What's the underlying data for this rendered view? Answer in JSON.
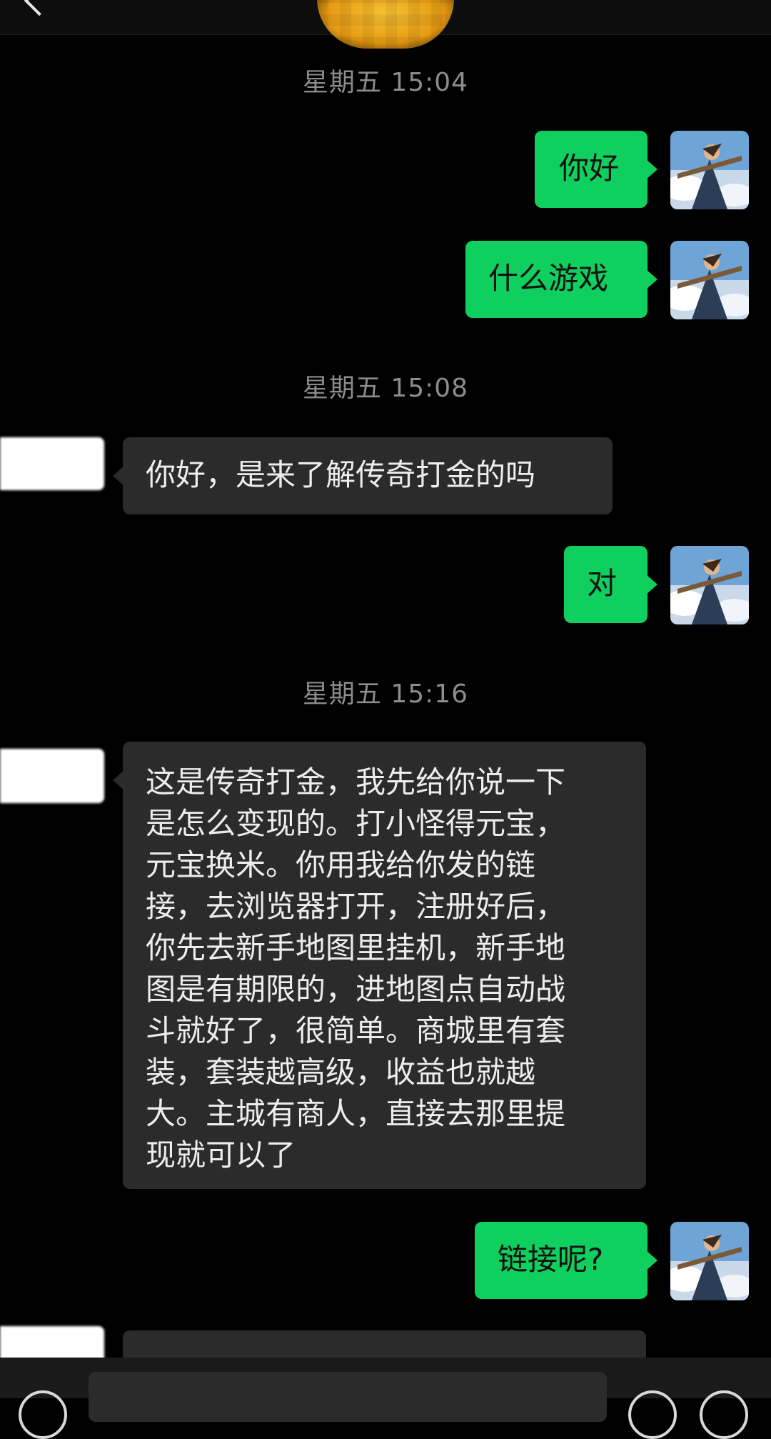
{
  "header": {
    "back_icon": "back-arrow-icon",
    "contact_avatar": "pixelated-emoji-avatar"
  },
  "messages": [
    {
      "type": "time",
      "text": "星期五 15:04"
    },
    {
      "type": "sent",
      "text": "你好"
    },
    {
      "type": "sent",
      "text": "什么游戏"
    },
    {
      "type": "time",
      "text": "星期五 15:08"
    },
    {
      "type": "received",
      "text": "你好，是来了解传奇打金的吗"
    },
    {
      "type": "sent",
      "text": "对"
    },
    {
      "type": "time",
      "text": "星期五 15:16"
    },
    {
      "type": "received",
      "text": "这是传奇打金，我先给你说一下\n是怎么变现的。打小怪得元宝，\n元宝换米。你用我给你发的链\n接，去浏览器打开，注册好后，\n你先去新手地图里挂机，新手地\n图是有期限的，进地图点自动战\n斗就好了，很简单。商城里有套\n装，套装越高级，收益也就越\n大。主城有商人，直接去那里提\n现就可以了"
    },
    {
      "type": "sent",
      "text": "链接呢?"
    }
  ],
  "colors": {
    "background": "#000000",
    "sent_bubble": "#0fcf5f",
    "received_bubble": "#2b2b2b",
    "timestamp_text": "#8c8c8c"
  },
  "input_bar": {
    "voice_icon": "voice-icon",
    "emoji_icon": "emoji-icon",
    "plus_icon": "plus-icon"
  }
}
